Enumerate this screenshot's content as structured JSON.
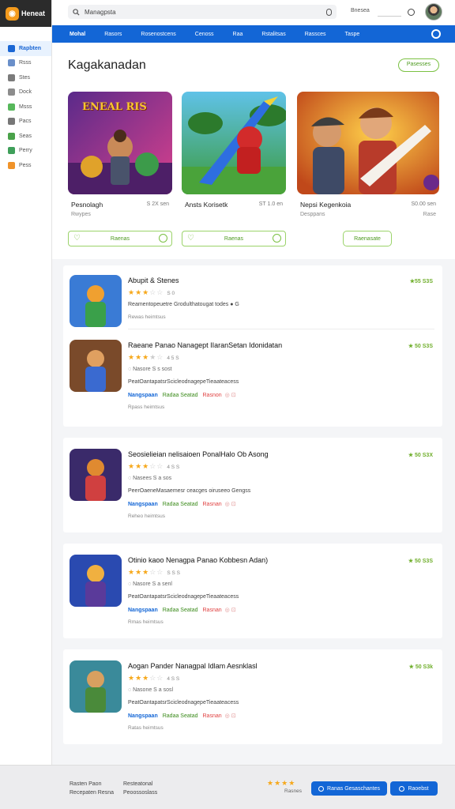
{
  "app": {
    "logo_text": "Heneat"
  },
  "sidebar": {
    "items": [
      {
        "label": "Rapbten",
        "icon": "compass-icon",
        "color": "#1a66d4",
        "active": true
      },
      {
        "label": "Rsss",
        "icon": "grid-icon",
        "color": "#6a8fc9"
      },
      {
        "label": "Stes",
        "icon": "book-icon",
        "color": "#7b7b7b"
      },
      {
        "label": "Dock",
        "icon": "dock-icon",
        "color": "#8c8c8c"
      },
      {
        "label": "Msss",
        "icon": "chart-icon",
        "color": "#57b85b"
      },
      {
        "label": "Pacs",
        "icon": "photo-icon",
        "color": "#777777"
      },
      {
        "label": "Seas",
        "icon": "bag-icon",
        "color": "#4aa24a"
      },
      {
        "label": "Perry",
        "icon": "gamepad-icon",
        "color": "#3f9f5a"
      },
      {
        "label": "Pess",
        "icon": "star-icon",
        "color": "#f0932a"
      }
    ]
  },
  "topbar": {
    "search_label": "Managpsta",
    "extra_label": "Bnesea"
  },
  "nav": {
    "items": [
      "Mohal",
      "Rasors",
      "Rosenostcens",
      "Cenoss",
      "Raa",
      "Rstalitsas",
      "Rassces",
      "Taspe"
    ]
  },
  "featured": {
    "title": "Kagakanadan",
    "view_all_label": "Pasesses",
    "cards": [
      {
        "title": "Pesnolagh",
        "meta": "S 2X sen",
        "sub": "Rwypes",
        "sub2": "",
        "button": "Raenas",
        "art_text": "ENEAL RIS"
      },
      {
        "title": "Ansts Korisetk",
        "meta": "ST 1.0 en",
        "sub": "",
        "sub2": "",
        "button": "Raenas",
        "art_text": ""
      },
      {
        "title": "Nepsi Kegenkoia",
        "meta": "S0.00 sen",
        "sub": "Desppans",
        "sub2": "Rase",
        "button": "Raenasate",
        "art_text": ""
      }
    ]
  },
  "list": [
    {
      "title": "Abupit & Stenes",
      "rating": "★55 S3S",
      "stars": "★★★",
      "half": "☆☆",
      "count": "S 0",
      "meta": "",
      "desc": "Reamentopeuetre Grodulthatougat todes ● G",
      "tags": [],
      "sub": "Rewas heimtsus",
      "art": "a1"
    },
    {
      "title": "Raeane Panao Nanagept IIaranSetan Idonidatan",
      "rating": "★ 50 S3S",
      "stars": "★★★",
      "half": "★☆",
      "count": "4 5 S",
      "meta": "◌ Nasore S s sost",
      "desc": "PeatOantapatsrScicleodnagepeTieaateacess",
      "tags": [
        "Nangspaan",
        "Radaa Seatad",
        "Rasnon"
      ],
      "sub": "Rpass heimtsus",
      "art": "a2"
    },
    {
      "title": "Seosielieian nelisaioen PonalHalo Ob Asong",
      "rating": "★ 50 S3X",
      "stars": "★★★",
      "half": "☆☆",
      "count": "4 S S",
      "meta": "◌ Nasees S a sos",
      "desc": "PeerOaeneMasaemesr ceacges oiruseeo Gengss",
      "tags": [
        "Nangspaan",
        "Radaa Seatad",
        "Rasnan"
      ],
      "sub": "Reheo heimtsus",
      "art": "a3"
    },
    {
      "title": "Otinio kaoo Nenagpa Panao Kobbesn Adan)",
      "rating": "★ 50 S3S",
      "stars": "★★★",
      "half": "☆☆",
      "count": "S S S",
      "meta": "◌ Nasore S a senl",
      "desc": "PeatOantapatsrScicleodnagepeTieaateacess",
      "tags": [
        "Nangspaan",
        "Radaa Seatad",
        "Rasnan"
      ],
      "sub": "Rmas heimtsus",
      "art": "a4"
    },
    {
      "title": "Aogan Pander Nanagpal Idlam Aesnklasl",
      "rating": "★ 50 S3k",
      "stars": "★★★",
      "half": "☆☆",
      "count": "4 S S",
      "meta": "◌ Nasone S a sosl",
      "desc": "PeatOantapatsrScicleodnagepeTieaateacess",
      "tags": [
        "Nangspaan",
        "Radaa Seatad",
        "Rasnan"
      ],
      "sub": "Ratas heimtsus",
      "art": "a5"
    }
  ],
  "footer": {
    "col1": [
      "Rasten Paon",
      "Recepaten Resna"
    ],
    "col2": [
      "Resteatonal",
      "Peoossoslass"
    ],
    "stars": "★★★★",
    "stars_sub": "Rasnes",
    "btn1": "Ranas Gesaschantes",
    "btn2": "Raoebst"
  },
  "colors": {
    "accent": "#1366d6",
    "green": "#7bc143",
    "star": "#f6a81b"
  }
}
